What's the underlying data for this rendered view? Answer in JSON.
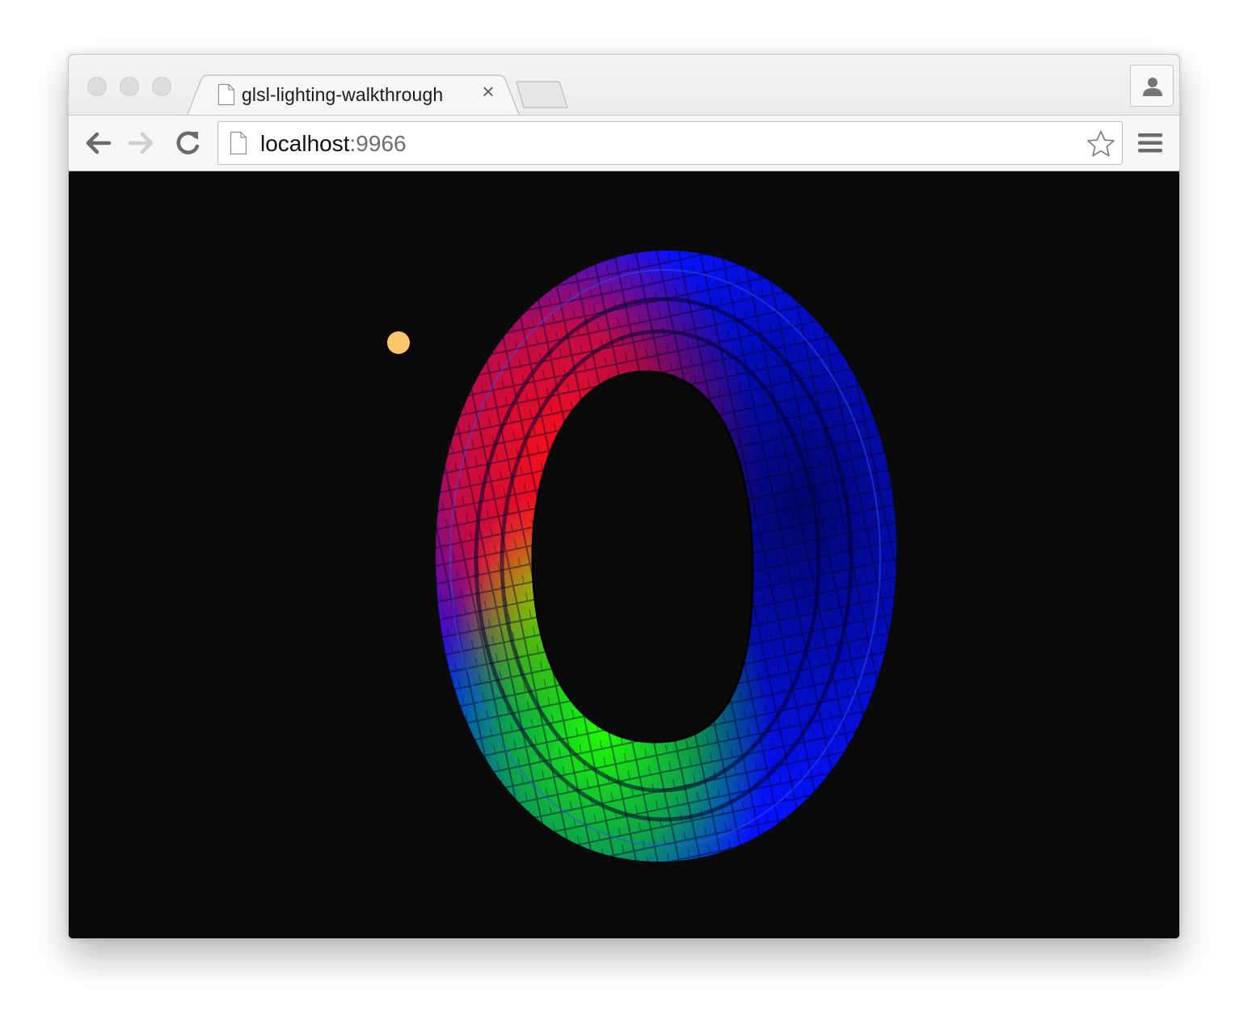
{
  "browser": {
    "tab": {
      "title": "glsl-lighting-walkthrough",
      "close_glyph": "×",
      "favicon": "page-icon"
    },
    "address_bar": {
      "host": "localhost",
      "port": ":9966"
    },
    "icons": {
      "back": "back-arrow-icon",
      "forward": "forward-arrow-icon",
      "reload": "reload-icon",
      "bookmark": "star-icon",
      "menu": "hamburger-menu-icon",
      "profile": "person-icon"
    }
  },
  "scene": {
    "background": "#0a0a0a",
    "light_color": "#ffc66a",
    "torus_colors": [
      "#0000ff",
      "#ff0000",
      "#00ff00"
    ]
  }
}
